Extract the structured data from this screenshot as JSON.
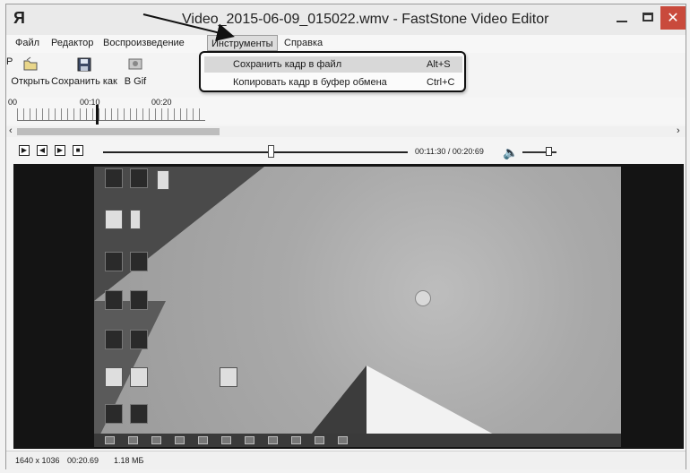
{
  "window": {
    "app_icon_glyph": "Я",
    "title": "Video_2015-06-09_015022.wmv - FastStone Video Editor",
    "controls": {
      "minimize": "minimize-icon",
      "maximize": "maximize-icon",
      "close_glyph": "✕"
    }
  },
  "menu": {
    "file": "Файл",
    "edit": "Редактор",
    "playback": "Воспроизведение",
    "tools": "Инструменты",
    "help": "Справка"
  },
  "toolbar": {
    "open": "Открыть",
    "save_as": "Сохранить как",
    "to_gif": "В Gif",
    "more_partial": "Р"
  },
  "tools_dropdown": {
    "items": [
      {
        "label": "Сохранить кадр в файл",
        "shortcut": "Alt+S"
      },
      {
        "label": "Копировать кадр в буфер обмена",
        "shortcut": "Ctrl+C"
      }
    ]
  },
  "timeline": {
    "ticks": [
      "00",
      "00:10",
      "00:20"
    ]
  },
  "player": {
    "time": "00:11:30 / 00:20:69",
    "seek_position_fraction": 0.55,
    "volume_fraction": 0.75
  },
  "status": {
    "resolution": "1640 x 1036",
    "duration": "00:20.69",
    "size": "1.18 МБ"
  },
  "accent": {
    "close_button": "#c94a3c",
    "dropdown_outline": "#111111"
  }
}
